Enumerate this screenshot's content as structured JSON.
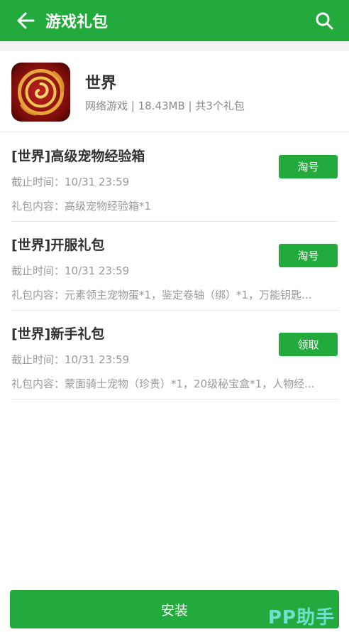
{
  "header": {
    "title": "游戏礼包",
    "bg_color": "#22ab3c"
  },
  "app": {
    "name": "世界",
    "meta": "网络游戏 | 18.43MB | 共3个礼包"
  },
  "gifts": [
    {
      "title": "[世界]高级宠物经验箱",
      "deadline": "截止时间：10/31 23:59",
      "content": "礼包内容：高级宠物经验箱*1",
      "button": "淘号"
    },
    {
      "title": "[世界]开服礼包",
      "deadline": "截止时间：10/31 23:59",
      "content": "礼包内容：元素领主宠物蛋*1，鉴定卷轴（绑）*1，万能钥匙...",
      "button": "淘号"
    },
    {
      "title": "[世界]新手礼包",
      "deadline": "截止时间：10/31 23:59",
      "content": "礼包内容：蒙面骑士宠物（珍贵）*1，20级秘宝盒*1，人物经...",
      "button": "领取"
    }
  ],
  "install_label": "安装",
  "watermark": "PP助手"
}
